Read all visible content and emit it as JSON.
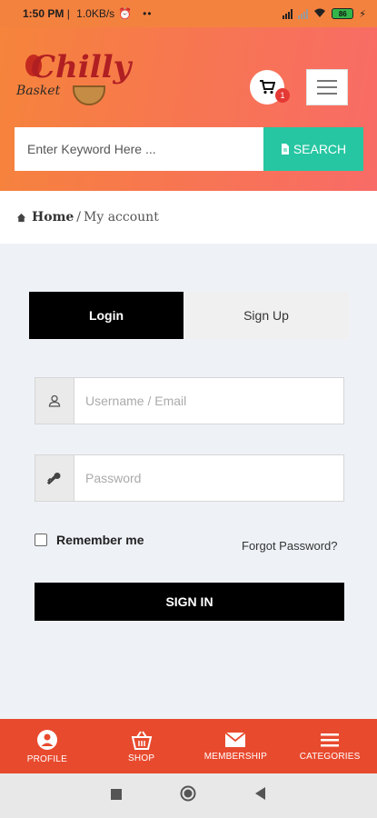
{
  "status": {
    "time": "1:50 PM",
    "net": "1.0KB/s",
    "dots": "••",
    "battery": "86"
  },
  "brand": {
    "line1": "Chilly",
    "line2": "Basket"
  },
  "cart": {
    "count": "1"
  },
  "search": {
    "placeholder": "Enter Keyword Here ...",
    "button_label": "SEARCH"
  },
  "breadcrumb": {
    "home": "Home",
    "separator": "/",
    "current": "My account"
  },
  "tabs": {
    "login": "Login",
    "signup": "Sign Up"
  },
  "form": {
    "username_placeholder": "Username / Email",
    "password_placeholder": "Password",
    "remember_label": "Remember me",
    "forgot_label": "Forgot Password?",
    "signin_label": "SIGN IN"
  },
  "bottom_nav": {
    "profile": "PROFILE",
    "shop": "SHOP",
    "membership": "MEMBERSHIP",
    "categories": "CATEGORIES"
  },
  "colors": {
    "header_start": "#f6843b",
    "header_end": "#f86b67",
    "search_button": "#26c6a2",
    "bottom_nav": "#e84a2e"
  }
}
